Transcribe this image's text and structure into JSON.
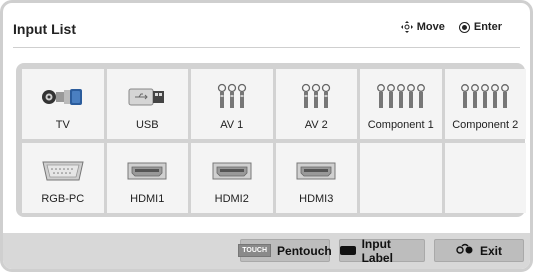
{
  "dialog": {
    "title": "Input List",
    "hints": {
      "move": "Move",
      "enter": "Enter"
    }
  },
  "inputs": [
    {
      "label": "TV",
      "icon": "tv-antenna-connector-icon"
    },
    {
      "label": "USB",
      "icon": "usb-drive-icon"
    },
    {
      "label": "AV 1",
      "icon": "av-rca-connector-icon"
    },
    {
      "label": "AV 2",
      "icon": "av-rca-connector-icon"
    },
    {
      "label": "Component 1",
      "icon": "component-rca-connector-icon"
    },
    {
      "label": "Component 2",
      "icon": "component-rca-connector-icon"
    },
    {
      "label": "RGB-PC",
      "icon": "vga-connector-icon"
    },
    {
      "label": "HDMI1",
      "icon": "hdmi-connector-icon"
    },
    {
      "label": "HDMI2",
      "icon": "hdmi-connector-icon"
    },
    {
      "label": "HDMI3",
      "icon": "hdmi-connector-icon"
    },
    {
      "label": "",
      "icon": ""
    },
    {
      "label": "",
      "icon": ""
    }
  ],
  "footer": {
    "touch_tag": "TOUCH",
    "pentouch_label": "Pentouch",
    "input_label": "Input Label",
    "exit_label": "Exit"
  },
  "colors": {
    "panel_bg": "#d2d2d2",
    "tile_bg": "#f4f4f4",
    "button_bg": "#bdbdbd",
    "footer_bg": "#d8d8d8"
  }
}
